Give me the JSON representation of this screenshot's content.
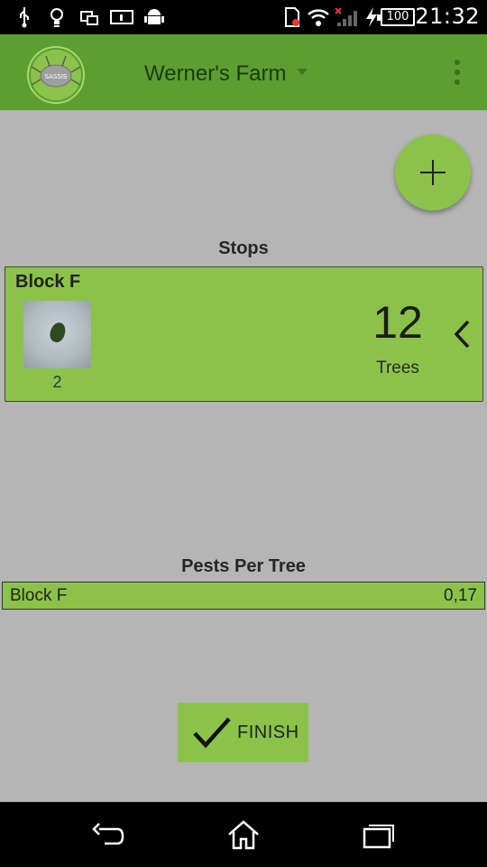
{
  "status_bar": {
    "time": "21:32",
    "battery": "100",
    "icons": [
      "usb-icon",
      "bulb-icon",
      "screens-icon",
      "info-icon",
      "android-icon",
      "sim-icon",
      "wifi-icon",
      "signal-icon",
      "charging-icon"
    ]
  },
  "action_bar": {
    "logo_text": "SASSIS",
    "title": "Werner's Farm"
  },
  "stops": {
    "heading": "Stops",
    "items": [
      {
        "name": "Block F",
        "photo_count": "2",
        "tree_count": "12",
        "tree_label": "Trees"
      }
    ]
  },
  "pests_per_tree": {
    "heading": "Pests Per Tree",
    "rows": [
      {
        "name": "Block F",
        "value": "0,17"
      }
    ]
  },
  "finish": {
    "label": "FINISH"
  },
  "colors": {
    "action_bar": "#5c9e32",
    "accent_green": "#8bc34a",
    "background": "#b5b5b5"
  }
}
